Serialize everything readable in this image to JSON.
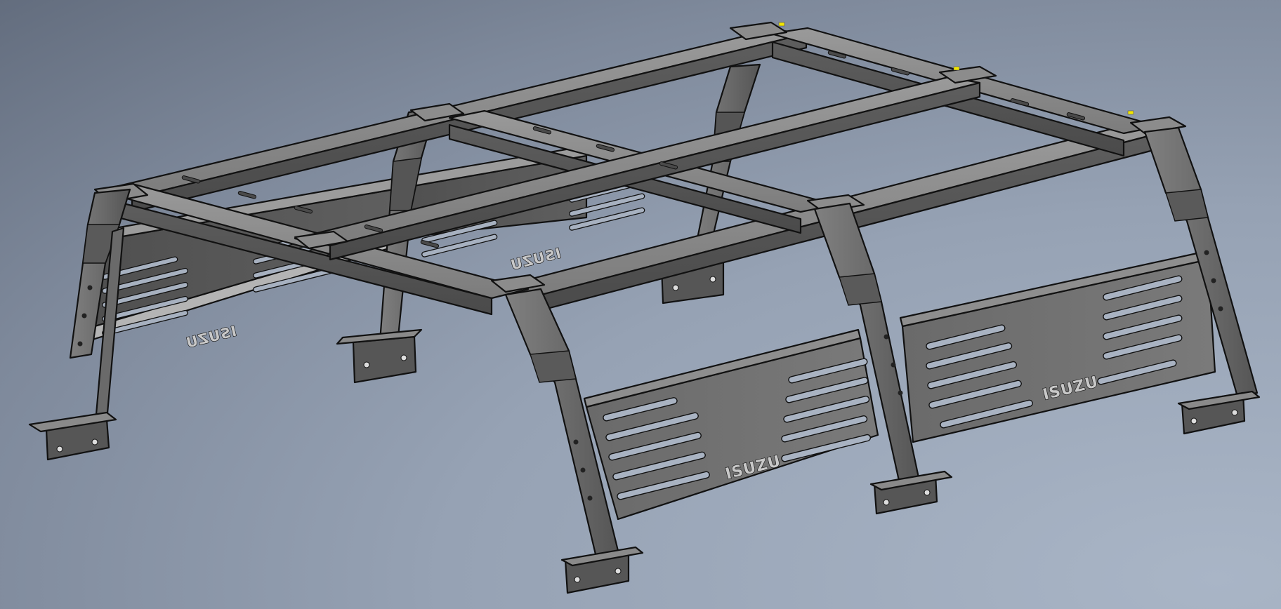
{
  "model": {
    "name": "truck bed rack",
    "logo_text": "ISUZU",
    "colors": {
      "background": "#8e9aac",
      "frame": "#6f6f6f",
      "frame_light": "#8a8a8a",
      "frame_dark": "#4a4a4a",
      "outline": "#111111",
      "marker": "#f2e600"
    }
  }
}
